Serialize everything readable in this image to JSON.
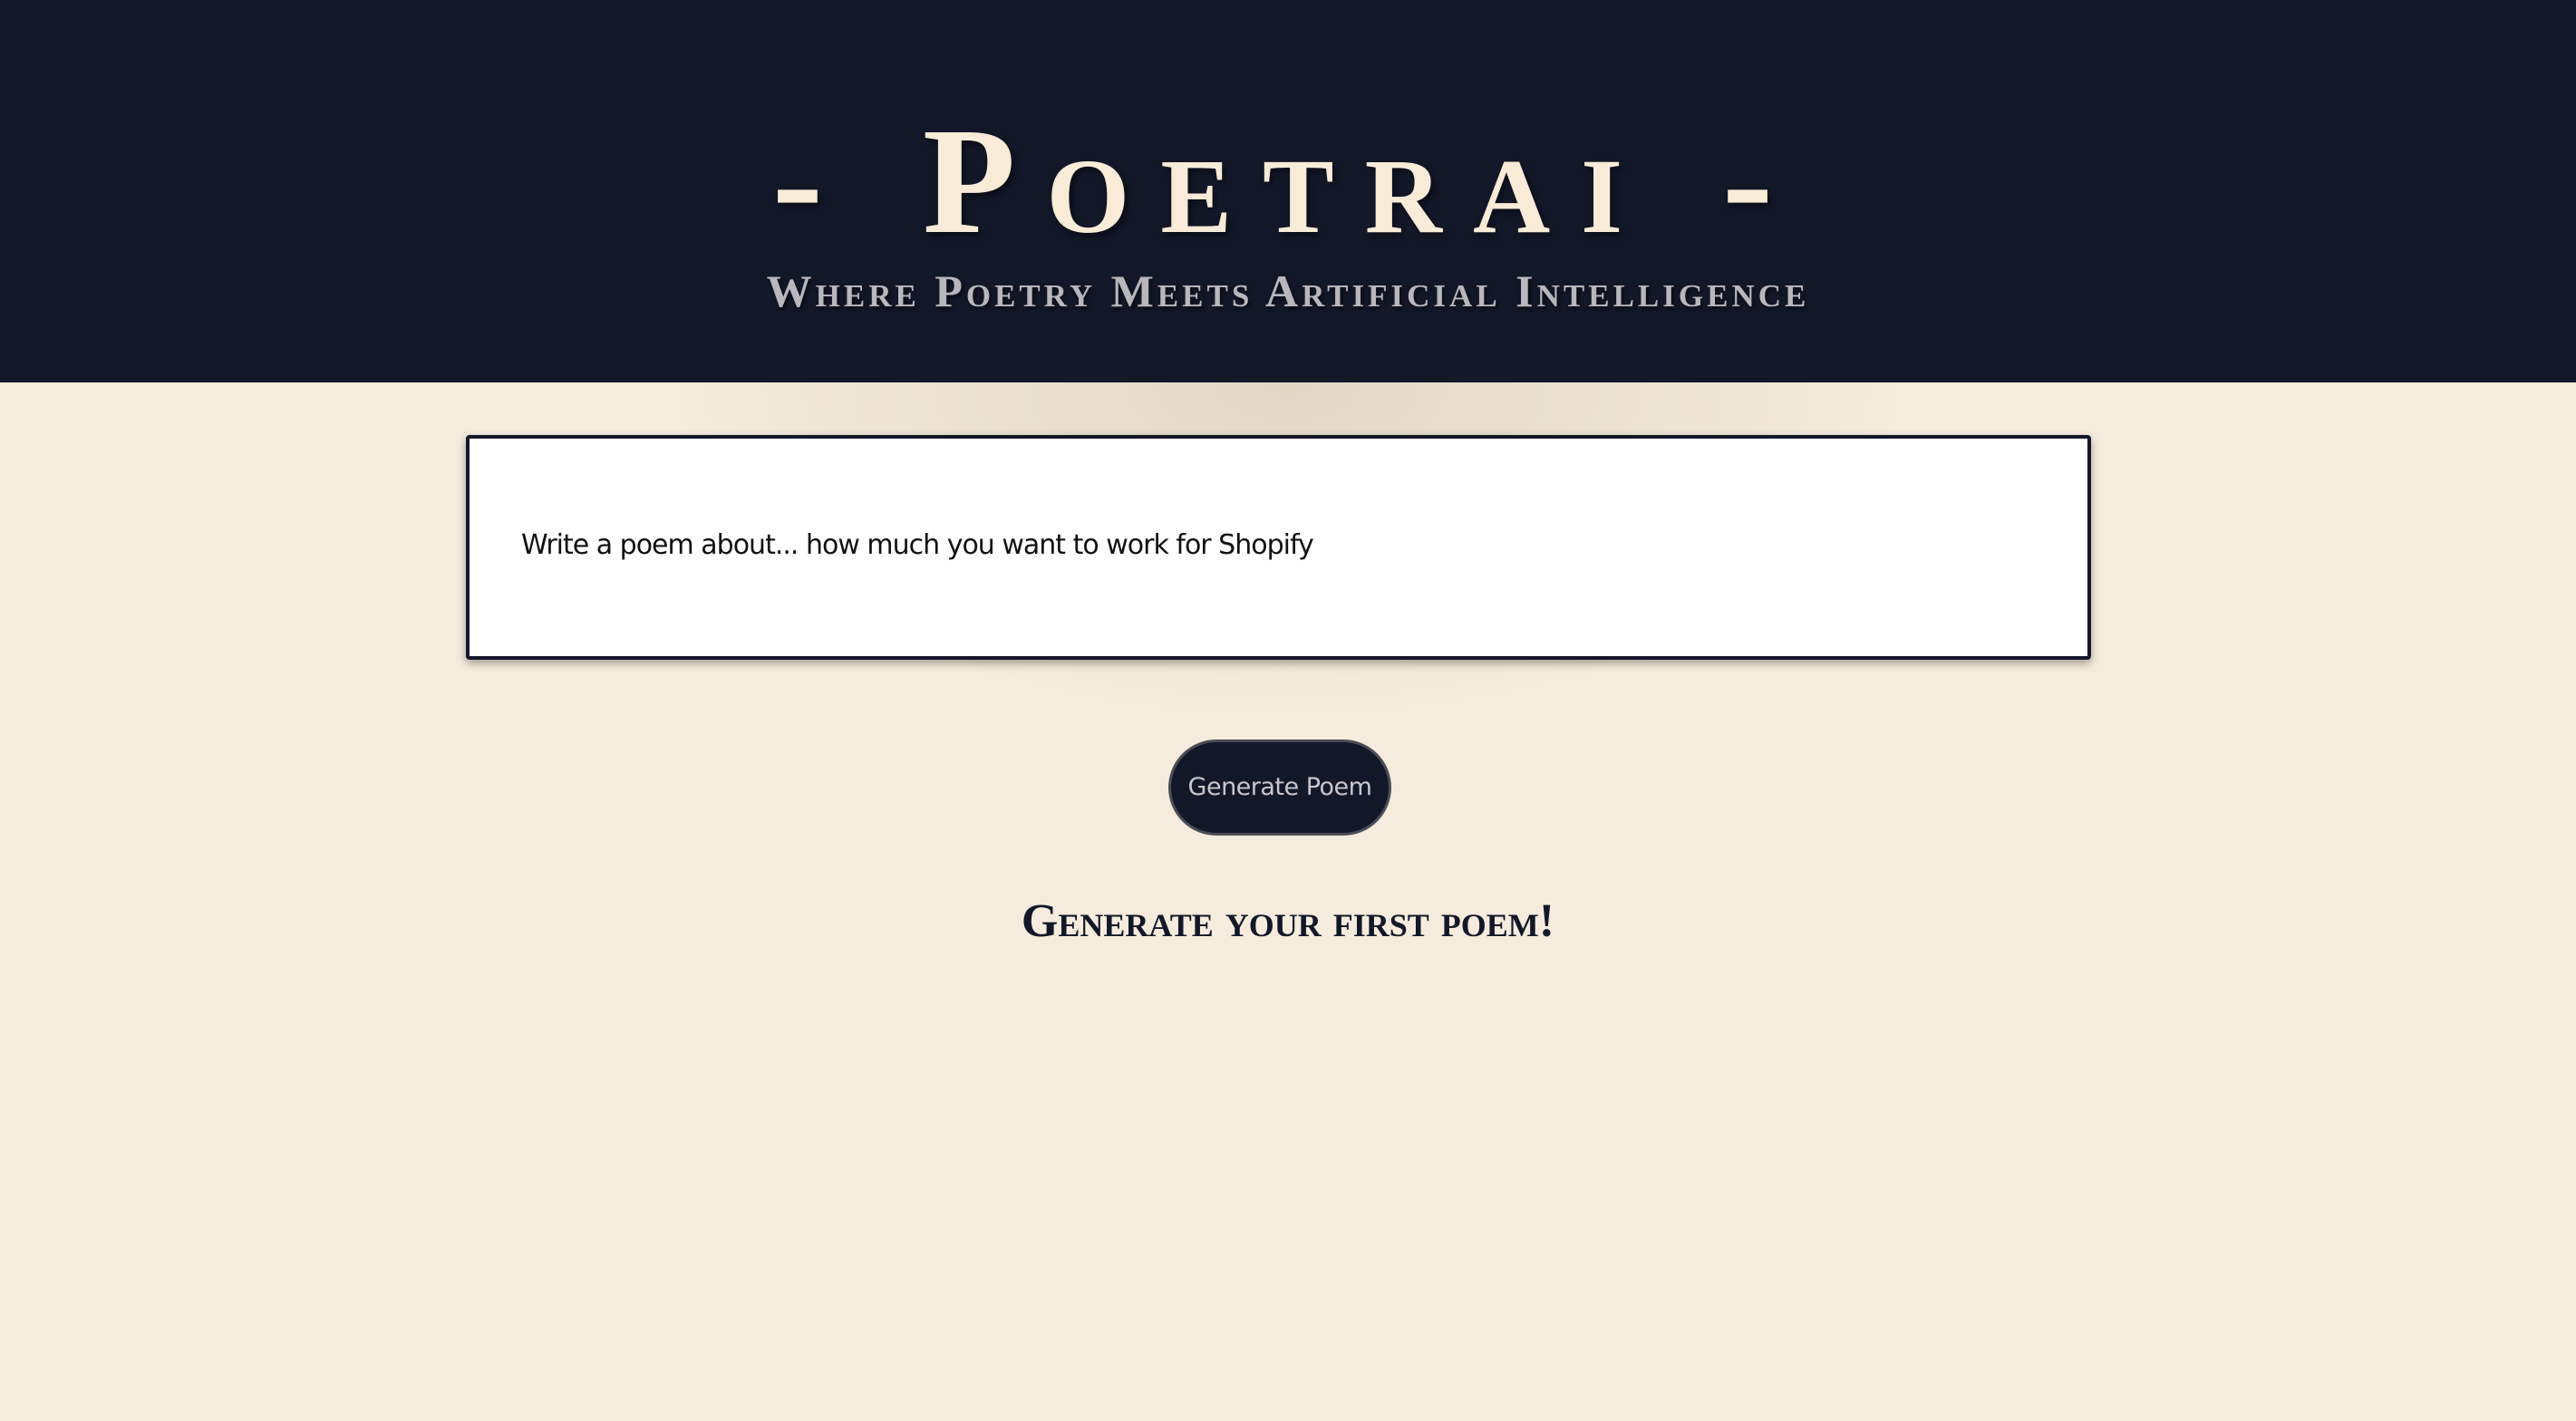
{
  "header": {
    "title": "- Poetrai -",
    "subtitle": "Where Poetry Meets Artificial Intelligence"
  },
  "prompt": {
    "value": "Write a poem about... how much you want to work for Shopify"
  },
  "actions": {
    "generate_label": "Generate Poem"
  },
  "results": {
    "empty_message": "Generate your first poem!"
  },
  "colors": {
    "header_bg": "#131829",
    "page_bg": "#f6ecdd",
    "title_text": "#f8ebd8",
    "button_bg": "#131829"
  }
}
